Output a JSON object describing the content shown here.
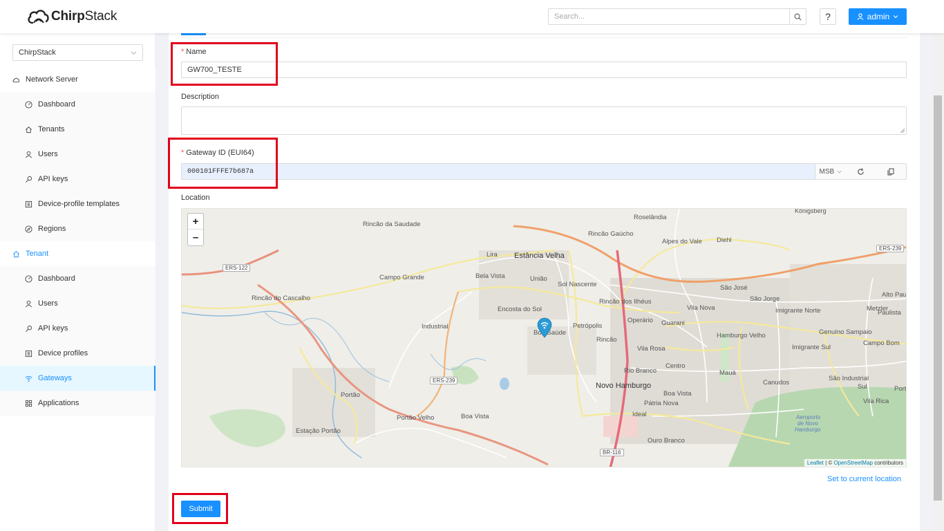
{
  "header": {
    "logo_bold": "Chirp",
    "logo_thin": "Stack",
    "search_placeholder": "Search...",
    "help_label": "?",
    "user_label": "admin"
  },
  "sidebar": {
    "tenant_selected": "ChirpStack",
    "network_server": {
      "label": "Network Server",
      "items": [
        {
          "label": "Dashboard",
          "icon": "dashboard-icon"
        },
        {
          "label": "Tenants",
          "icon": "home-icon"
        },
        {
          "label": "Users",
          "icon": "user-icon"
        },
        {
          "label": "API keys",
          "icon": "key-icon"
        },
        {
          "label": "Device-profile templates",
          "icon": "template-icon"
        },
        {
          "label": "Regions",
          "icon": "compass-icon"
        }
      ]
    },
    "tenant": {
      "label": "Tenant",
      "items": [
        {
          "label": "Dashboard",
          "icon": "dashboard-icon"
        },
        {
          "label": "Users",
          "icon": "user-icon"
        },
        {
          "label": "API keys",
          "icon": "key-icon"
        },
        {
          "label": "Device profiles",
          "icon": "template-icon"
        },
        {
          "label": "Gateways",
          "icon": "wifi-icon",
          "selected": true
        },
        {
          "label": "Applications",
          "icon": "apps-icon"
        }
      ]
    }
  },
  "form": {
    "name_label": "Name",
    "name_value": "GW700_TESTE",
    "description_label": "Description",
    "description_value": "",
    "gateway_id_label": "Gateway ID (EUI64)",
    "gateway_id_value": "000101FFFE7b687a",
    "byte_order": "MSB",
    "location_label": "Location",
    "set_location_label": "Set to current location",
    "submit_label": "Submit"
  },
  "map": {
    "zoom_in": "+",
    "zoom_out": "–",
    "attribution_leaflet": "Leaflet",
    "attribution_sep": " | © ",
    "attribution_osm": "OpenStreetMap",
    "attribution_suffix": " contributors",
    "places": {
      "konigsberg": "Königsberg",
      "roselandia": "Roselândia",
      "rincao_saudade": "Rincão da Saudade",
      "rincao_gaucho": "Rincão Gaúcho",
      "alpes_do_vale": "Alpes do Vale",
      "diehl": "Diehl",
      "lira": "Lira",
      "estancia_velha": "Estância Velha",
      "campo_grande": "Campo Grande",
      "bela_vista": "Bela Vista",
      "uniao": "União",
      "sol_nascente": "Sol Nascente",
      "sao_jose": "São José",
      "alto_paulista": "Alto Paulista",
      "rincao_cascalho": "Rincão do Cascalho",
      "encosta_sol": "Encosta do Sol",
      "rincao_ilheus": "Rincão dos Ilhéus",
      "sao_jorge": "São Jorge",
      "vila_nova": "Vila Nova",
      "imigrante_norte": "Imigrante Norte",
      "metzler": "Metzler",
      "paulista": "Paulista",
      "industrial": "Industrial",
      "petropolis": "Petrópolis",
      "operario": "Operário",
      "guarani": "Guarani",
      "boa_saude": "Boa Saúde",
      "hamburgo_velho": "Hamburgo Velho",
      "genuino_sampaio": "Genuíno Sampaio",
      "rincao": "Rincão",
      "campo_bom": "Campo Bom",
      "vila_rosa": "Vila Rosa",
      "imigrante_sul": "Imigrante Sul",
      "centro": "Centro",
      "rio_branco": "Rio Branco",
      "maua": "Mauá",
      "sao_industrial": "São Industrial",
      "sul": "Sul",
      "novo_hamburgo": "Novo Hamburgo",
      "canudos": "Canudos",
      "porto_bl": "Porto Bl",
      "portao": "Portão",
      "boa_vista2": "Boa Vista",
      "patria_nova": "Pátria Nova",
      "vila_rica": "Vila Rica",
      "portao_velho": "Portão Velho",
      "boa_vista": "Boa Vista",
      "ideal": "Ideal",
      "aeroporto": "Aeroporto",
      "de_novo": "de Novo",
      "hamburgo": "Hamburgo",
      "estacao_portao": "Estação Portão",
      "ouro_branco": "Ouro Branco"
    },
    "roads": {
      "ers239_top": "ERS-239",
      "ers122": "ERS-122",
      "ers239_mid": "ERS-239",
      "br116": "BR-116"
    }
  }
}
